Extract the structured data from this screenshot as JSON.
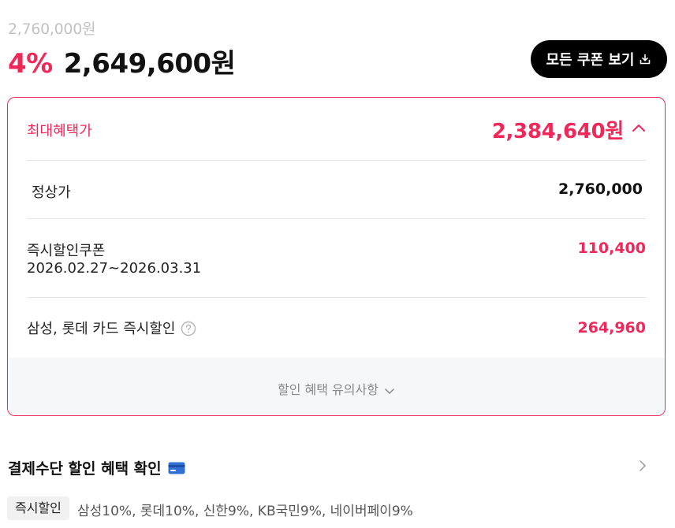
{
  "product": {
    "original_price": "2,760,000원",
    "discount_rate": "4%",
    "sale_price": "2,649,600원"
  },
  "coupon_button": {
    "label": "모든 쿠폰 보기",
    "icon": "download-icon"
  },
  "benefit_card": {
    "max_label": "최대혜택가",
    "max_amount": "2,384,640원",
    "regular": {
      "label": "정상가",
      "amount": "2,760,000"
    },
    "coupon": {
      "label": "즉시할인쿠폰",
      "period": "2026.02.27~2026.03.31",
      "amount": "110,400"
    },
    "card_discount": {
      "label": "삼성, 롯데 카드 즉시할인",
      "amount": "264,960"
    },
    "notice_label": "할인 혜택 유의사항"
  },
  "payment_section": {
    "title": "결제수단 할인 혜택 확인",
    "tag": "즉시할인",
    "cards": "삼성10%, 롯데10%, 신한9%, KB국민9%, 네이버페이9%"
  },
  "colors": {
    "accent": "#f0285a",
    "button_bg": "#000000",
    "muted": "#c2c2c2",
    "card_icon": "#2f6fd6"
  }
}
